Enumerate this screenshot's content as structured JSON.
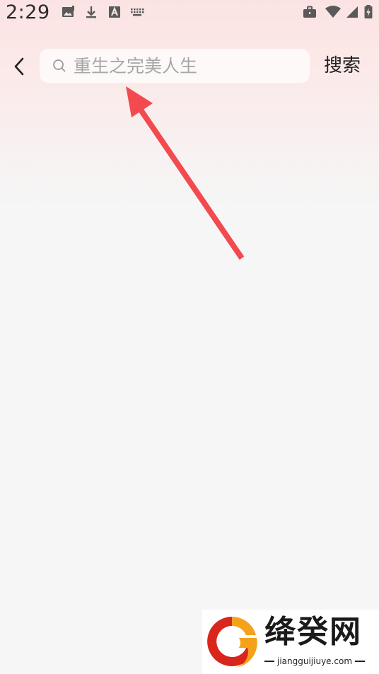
{
  "status_bar": {
    "time": "2:29",
    "left_icons": [
      "image-icon",
      "download-icon",
      "font-a-icon",
      "keyboard-icon"
    ],
    "right_icons": [
      "briefcase-icon",
      "wifi-icon",
      "cellular-signal-icon",
      "battery-charging-icon"
    ]
  },
  "header": {
    "back_icon": "chevron-left-icon",
    "search": {
      "placeholder": "重生之完美人生",
      "value": "",
      "icon": "search-icon"
    },
    "search_button_label": "搜索"
  },
  "annotation": {
    "type": "arrow",
    "color": "#f24a4f",
    "points_to": "search-input"
  },
  "watermark": {
    "title": "绛癸网",
    "domain": "jiangguijiuye.com",
    "colors": {
      "logo_orange": "#f5a21b",
      "logo_red": "#d9261c"
    }
  },
  "colors": {
    "background": "#f6f6f6",
    "header_tint": "#fbe3e3",
    "text_primary": "#222222",
    "placeholder": "#a7a7a7"
  }
}
